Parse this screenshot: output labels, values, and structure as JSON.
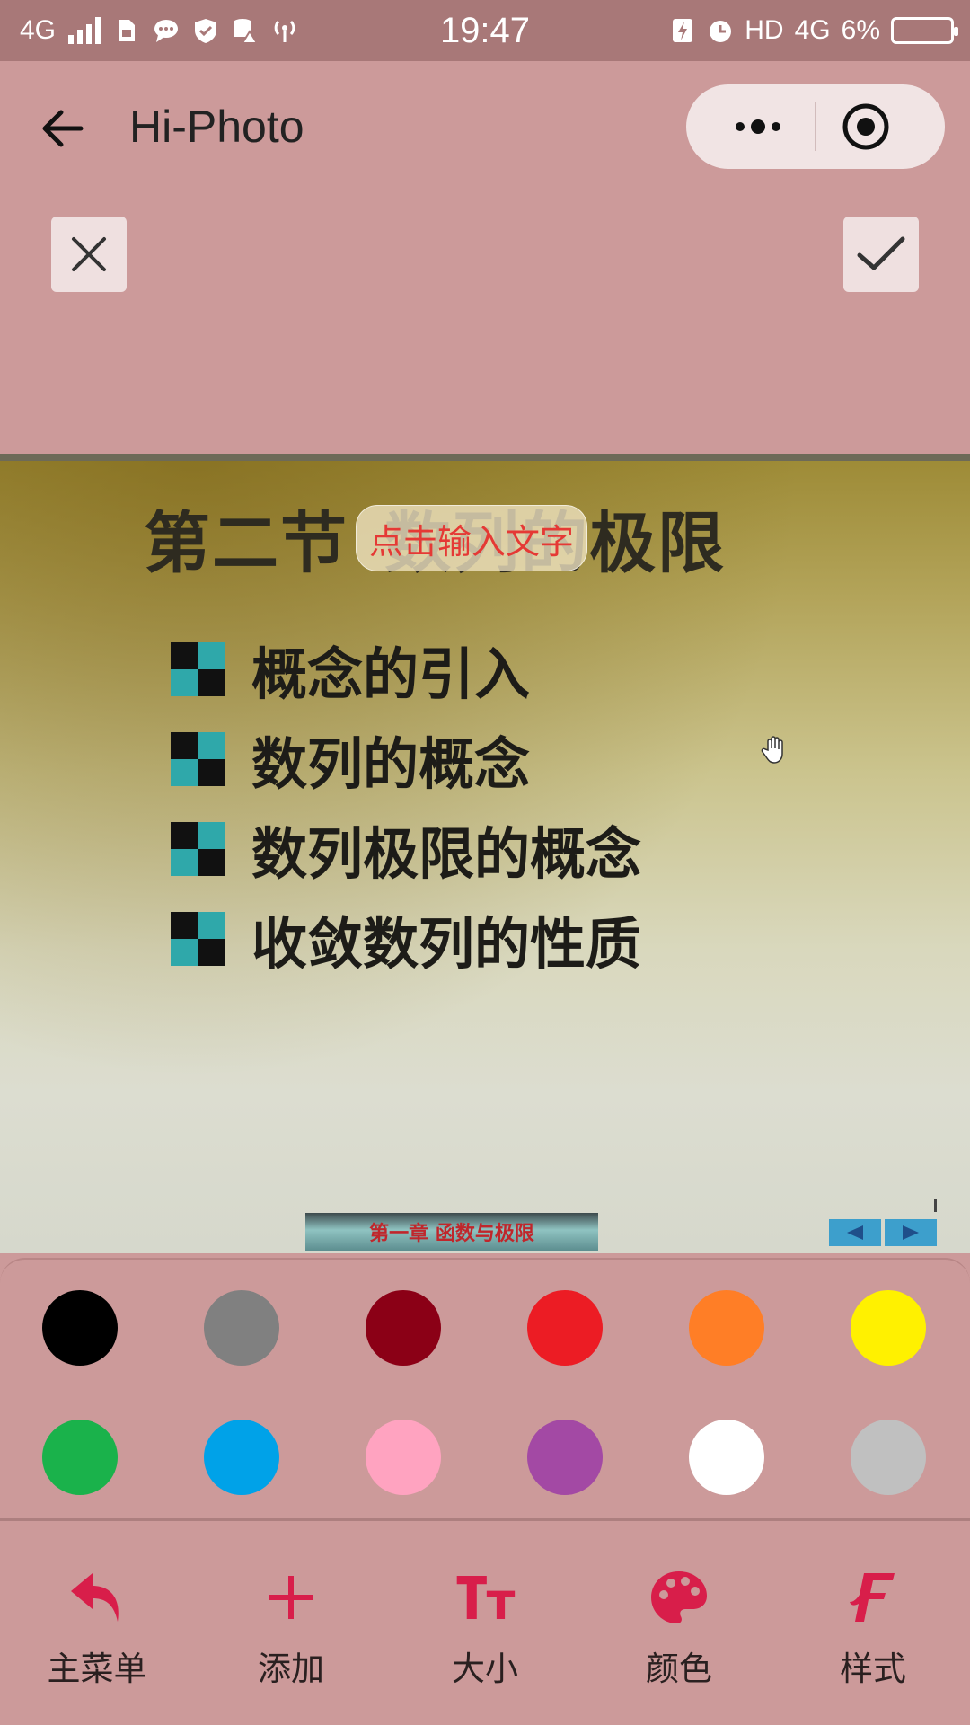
{
  "status_bar": {
    "network": "4G",
    "time": "19:47",
    "hd": "HD",
    "network_right": "4G",
    "battery": "6%"
  },
  "header": {
    "title": "Hi-Photo",
    "back_icon": "arrow-left-icon",
    "more_icon": "more-dots-icon",
    "target_icon": "target-circle-icon"
  },
  "edit_actions": {
    "cancel_icon": "close-icon",
    "confirm_icon": "check-icon"
  },
  "photo": {
    "slide_title_part1": "第二节",
    "slide_title_part2": "数列的极限",
    "bullets": [
      "概念的引入",
      "数列的概念",
      "数列极限的概念",
      "收敛数列的性质"
    ],
    "text_placeholder": "点击输入文字",
    "footer_banner": "第一章  函数与极限"
  },
  "palette": {
    "colors": [
      "#000000",
      "#808080",
      "#8b0016",
      "#ec1c24",
      "#ff7e26",
      "#fff100",
      "#1ab24b",
      "#00a2e8",
      "#ffa3c0",
      "#a349a4",
      "#ffffff",
      "#c0c0c0"
    ]
  },
  "toolbar": {
    "accent": "#d81e4a",
    "items": [
      {
        "label": "主菜单",
        "icon": "undo-arrow-icon"
      },
      {
        "label": "添加",
        "icon": "plus-icon"
      },
      {
        "label": "大小",
        "icon": "text-size-icon"
      },
      {
        "label": "颜色",
        "icon": "palette-icon"
      },
      {
        "label": "样式",
        "icon": "font-style-icon"
      }
    ]
  }
}
